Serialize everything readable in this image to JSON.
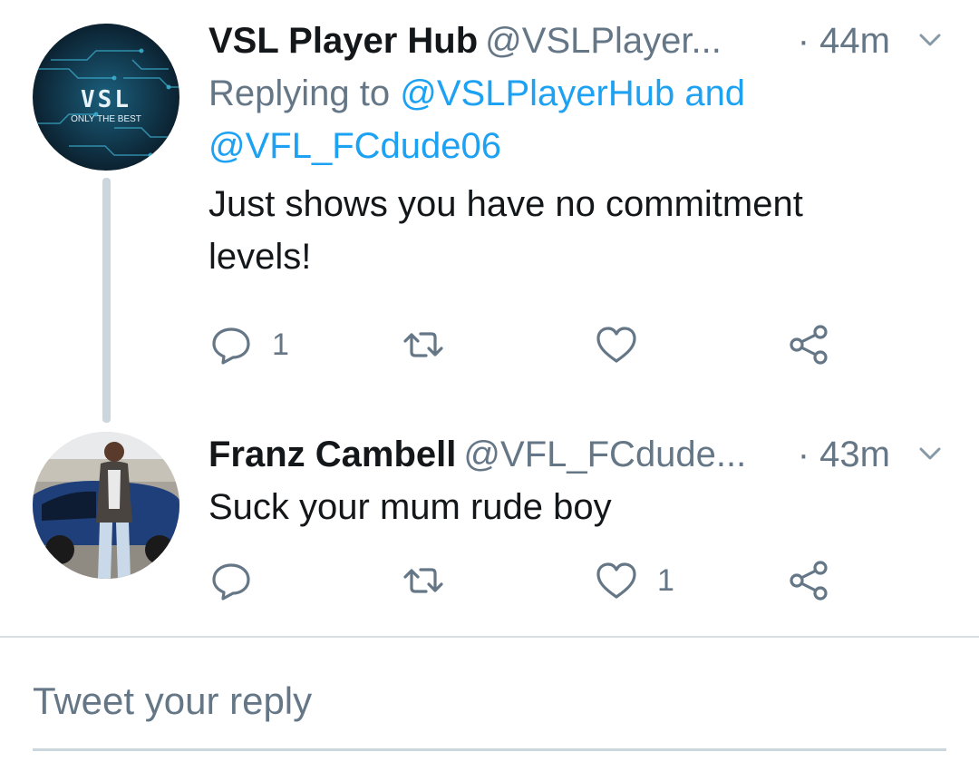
{
  "tweets": [
    {
      "name": "VSL Player Hub",
      "handle": "@VSLPlayer...",
      "time": "· 44m",
      "avatar": {
        "title": "VSL",
        "subtitle": "ONLY THE BEST",
        "colors": [
          "#0b1a2b",
          "#1c6a8a"
        ]
      },
      "replying_prefix": "Replying to ",
      "replying_mention_1": "@VSLPlayerHub",
      "replying_and": " and",
      "replying_mention_2": "@VFL_FCdude06",
      "text_line_1": "Just shows you have no commitment",
      "text_line_2": "levels!",
      "reply_count": "1",
      "retweet_count": "",
      "like_count": ""
    },
    {
      "name": "Franz Cambell",
      "handle": "@VFL_FCdude...",
      "time": "· 43m",
      "text_line_1": "Suck your mum rude boy",
      "reply_count": "",
      "retweet_count": "",
      "like_count": "1"
    }
  ],
  "reply_box": {
    "placeholder": "Tweet your reply"
  },
  "icons": {
    "reply": "reply-icon",
    "retweet": "retweet-icon",
    "like": "heart-icon",
    "share": "share-icon",
    "menu": "chevron-down-icon"
  },
  "colors": {
    "text": "#14171a",
    "secondary": "#657786",
    "link": "#1da1f2",
    "thread_line": "#ccd6dd"
  }
}
